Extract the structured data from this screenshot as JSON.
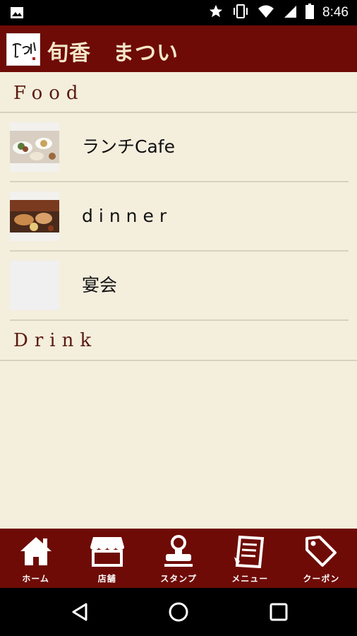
{
  "status_bar": {
    "time": "8:46",
    "icons": [
      "image-icon",
      "star-icon",
      "vibrate-icon",
      "wifi-icon",
      "signal-icon",
      "battery-icon"
    ]
  },
  "header": {
    "title": "旬香　まつい",
    "logo_text": "まつい",
    "background": "#6e0b06"
  },
  "sections": [
    {
      "title": "Food",
      "items": [
        {
          "label": "ランチCafe",
          "thumb": "lunch-photo"
        },
        {
          "label": "dinner",
          "thumb": "dinner-photo"
        },
        {
          "label": "宴会",
          "thumb": "empty-thumbnail"
        }
      ]
    },
    {
      "title": "Drink",
      "items": []
    }
  ],
  "bottom_nav": [
    {
      "label": "ホーム",
      "icon": "home-icon"
    },
    {
      "label": "店舗",
      "icon": "store-icon"
    },
    {
      "label": "スタンプ",
      "icon": "stamp-icon"
    },
    {
      "label": "メニュー",
      "icon": "menu-icon"
    },
    {
      "label": "クーポン",
      "icon": "coupon-icon"
    }
  ],
  "system_nav": [
    "back-icon",
    "home-circle-icon",
    "recents-icon"
  ],
  "colors": {
    "accent": "#6e0b06",
    "background": "#f4eedd",
    "section_text": "#5a1a10"
  }
}
